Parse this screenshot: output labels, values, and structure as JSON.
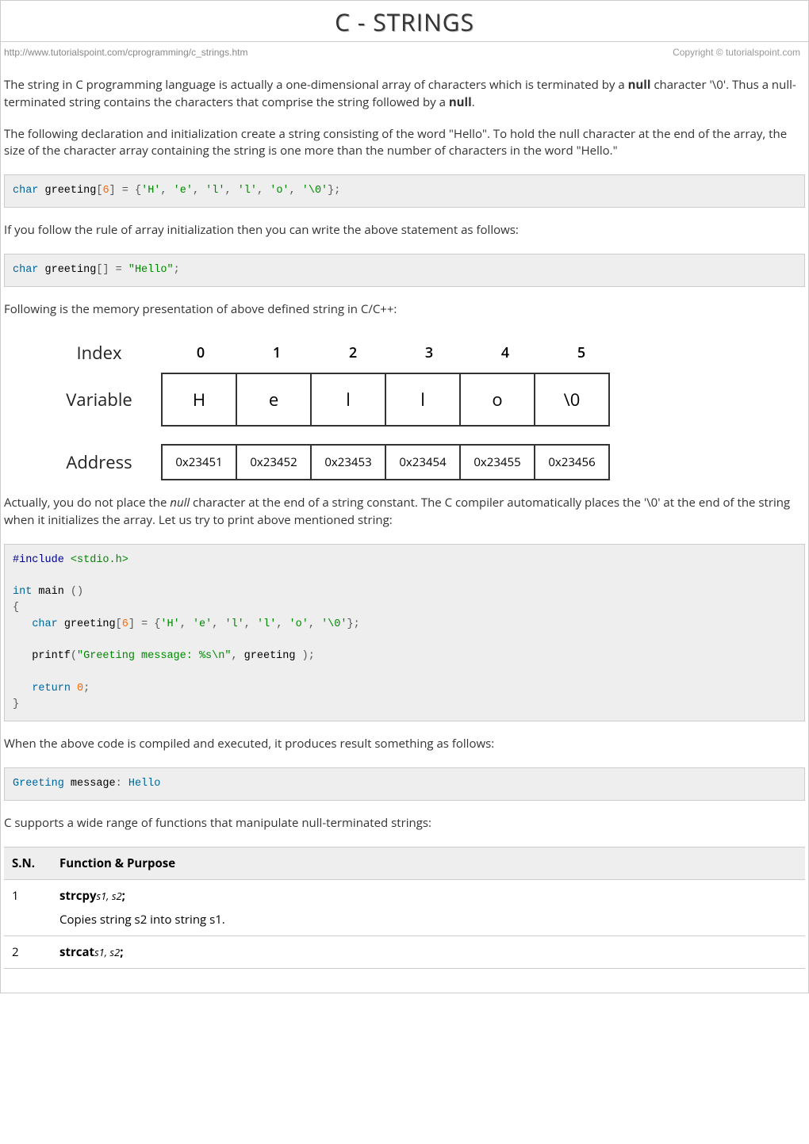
{
  "title": "C - STRINGS",
  "meta": {
    "url": "http://www.tutorialspoint.com/cprogramming/c_strings.htm",
    "copyright": "Copyright © tutorialspoint.com"
  },
  "para1_pre": "The string in C programming language is actually a one-dimensional array of characters which is terminated by a ",
  "para1_null": "null",
  "para1_mid": " character '\\0'. Thus a null-terminated string contains the characters that comprise the string followed by a ",
  "para1_null2": "null",
  "para1_post": ".",
  "para2": "The following declaration and initialization create a string consisting of the word \"Hello\". To hold the null character at the end of the array, the size of the character array containing the string is one more than the number of characters in the word \"Hello.\"",
  "code1": "char greeting[6] = {'H', 'e', 'l', 'l', 'o', '\\0'};",
  "para3": "If you follow the rule of array initialization then you can write the above statement as follows:",
  "code2": "char greeting[] = \"Hello\";",
  "para4": "Following is the memory presentation of above defined string in C/C++:",
  "diagram": {
    "labels": {
      "index": "Index",
      "variable": "Variable",
      "address": "Address"
    },
    "indexes": [
      "0",
      "1",
      "2",
      "3",
      "4",
      "5"
    ],
    "variables": [
      "H",
      "e",
      "l",
      "l",
      "o",
      "\\0"
    ],
    "addresses": [
      "0x23451",
      "0x23452",
      "0x23453",
      "0x23454",
      "0x23455",
      "0x23456"
    ]
  },
  "para5_pre": "Actually, you do not place the ",
  "para5_null": "null",
  "para5_post": " character at the end of a string constant. The C compiler automatically places the '\\0' at the end of the string when it initializes the array. Let us try to print above mentioned string:",
  "code3": "#include <stdio.h>\n\nint main ()\n{\n   char greeting[6] = {'H', 'e', 'l', 'l', 'o', '\\0'};\n\n   printf(\"Greeting message: %s\\n\", greeting );\n\n   return 0;\n}",
  "para6": "When the above code is compiled and executed, it produces result something as follows:",
  "code4": "Greeting message: Hello",
  "para7": "C supports a wide range of functions that manipulate null-terminated strings:",
  "table": {
    "head_sn": "S.N.",
    "head_fp": "Function & Purpose",
    "rows": [
      {
        "sn": "1",
        "fn": "strcpy",
        "args": "s1, s2",
        "semi": ";",
        "desc": "Copies string s2 into string s1."
      },
      {
        "sn": "2",
        "fn": "strcat",
        "args": "s1, s2",
        "semi": ";",
        "desc": ""
      }
    ]
  }
}
